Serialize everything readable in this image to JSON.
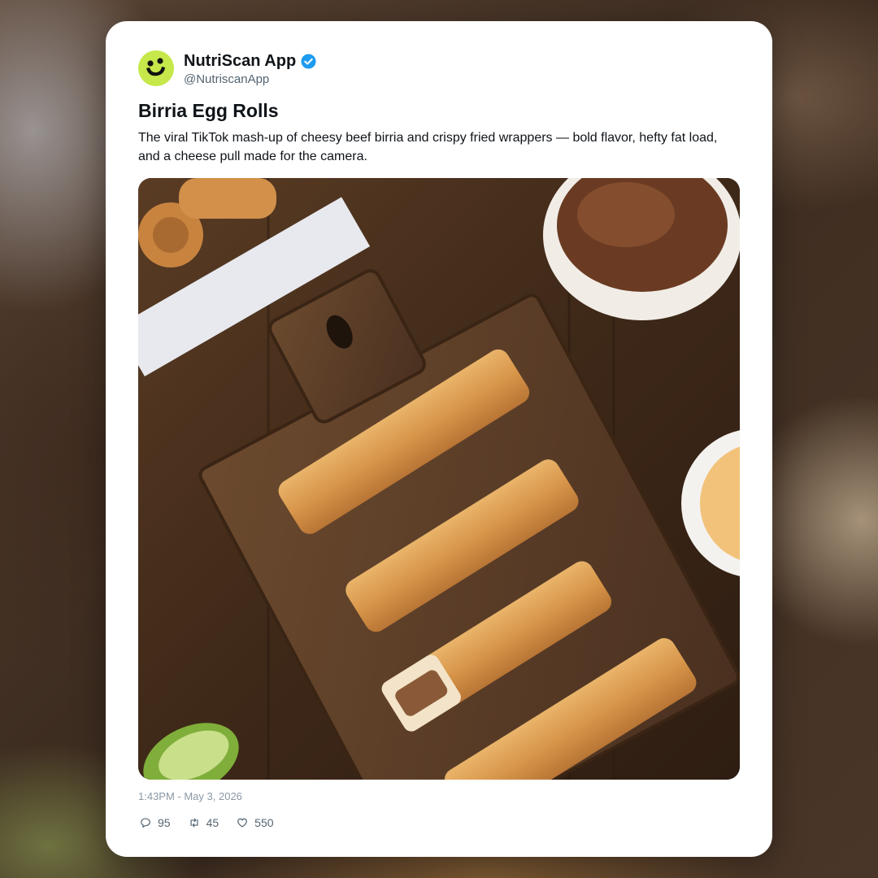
{
  "post": {
    "author_name": "NutriScan App",
    "author_handle": "@NutriscanApp",
    "verified": true,
    "title": "Birria Egg Rolls",
    "body": "The viral TikTok mash-up of cheesy beef birria and crispy fried wrappers — bold flavor, hefty fat load, and a cheese pull made for the camera.",
    "timestamp": "1:43PM - May 3, 2026",
    "replies": "95",
    "reposts": "45",
    "likes": "550"
  },
  "icons": {
    "avatar": "smiley-logo-icon",
    "verified": "verified-badge-icon",
    "reply": "comment-icon",
    "repost": "repost-icon",
    "like": "heart-icon"
  },
  "colors": {
    "avatar_bg": "#c6e84a",
    "verified_blue": "#1d9bf0",
    "text_primary": "#0f1419",
    "text_secondary": "#536471"
  }
}
